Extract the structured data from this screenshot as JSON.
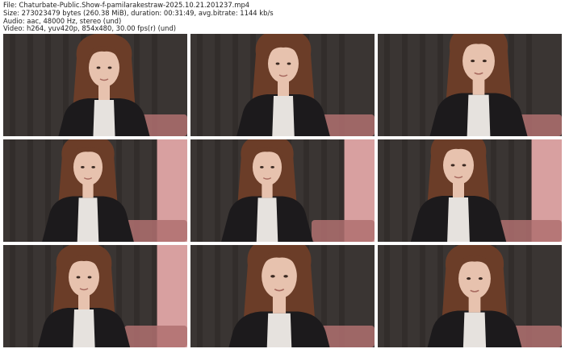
{
  "header": {
    "file_line": "File: Chaturbate-Public.Show-f-pamilarakestraw-2025.10.21.201237.mp4",
    "size_line": "Size: 273023479 bytes (260.38 MiB), duration: 00:31:49, avg.bitrate: 1144 kb/s",
    "audio_line": "Audio: aac, 48000 Hz, stereo (und)",
    "video_line": "Video: h264, yuv420p, 854x480, 30.00 fps(r) (und)"
  },
  "thumbnails": [
    {
      "variant": "hand-over-mouth",
      "curtain": "dark"
    },
    {
      "variant": "looking-down",
      "curtain": "dark"
    },
    {
      "variant": "smiling",
      "curtain": "dark"
    },
    {
      "variant": "smiling-wide",
      "curtain": "pink-wall"
    },
    {
      "variant": "smiling",
      "curtain": "pink-wall"
    },
    {
      "variant": "smiling-tilt",
      "curtain": "pink-wall"
    },
    {
      "variant": "closeup",
      "curtain": "pink-wall"
    },
    {
      "variant": "closeup-frown",
      "curtain": "dark"
    },
    {
      "variant": "hands-on-face",
      "curtain": "dark"
    }
  ],
  "colors": {
    "curtain_dark": "#3a3533",
    "curtain_fold": "#2b2725",
    "wall_pink": "#d8a0a0",
    "sofa_pink": "#b07070",
    "hair": "#6b3d28",
    "skin": "#e7c2ae",
    "jacket": "#1c1a1c",
    "shirt": "#e6e2de"
  }
}
